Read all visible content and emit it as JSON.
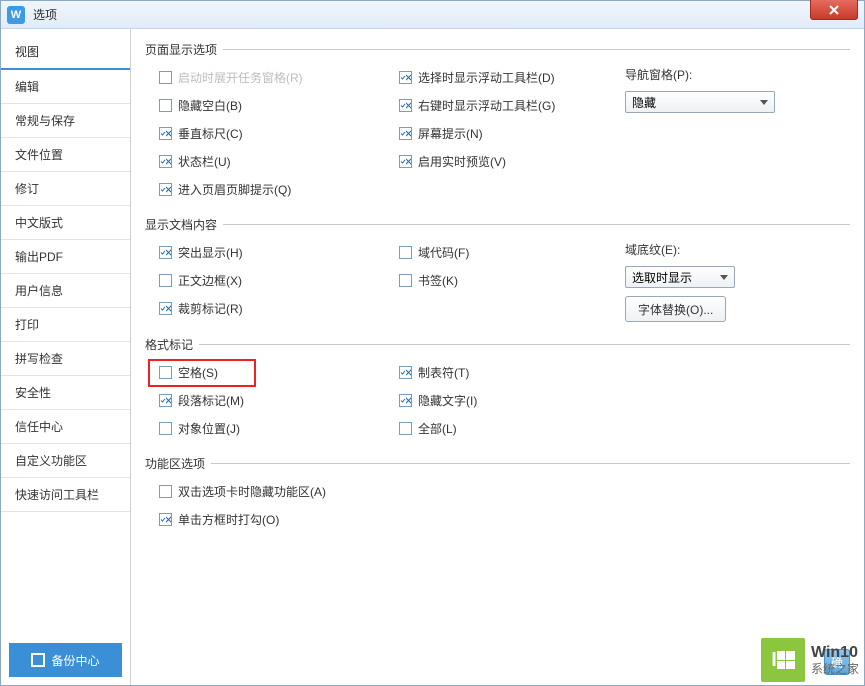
{
  "title": "选项",
  "sidebar": {
    "tabs": [
      "视图",
      "编辑",
      "常规与保存",
      "文件位置",
      "修订",
      "中文版式",
      "输出PDF",
      "用户信息",
      "打印",
      "拼写检查",
      "安全性",
      "信任中心",
      "自定义功能区",
      "快速访问工具栏"
    ],
    "selected_index": 0,
    "backup_label": "备份中心"
  },
  "groups": {
    "page_display": {
      "legend": "页面显示选项",
      "col1": [
        {
          "label": "启动时展开任务窗格(R)",
          "checked": false,
          "disabled": true
        },
        {
          "label": "隐藏空白(B)",
          "checked": false
        },
        {
          "label": "垂直标尺(C)",
          "checked": true
        },
        {
          "label": "状态栏(U)",
          "checked": true
        },
        {
          "label": "进入页眉页脚提示(Q)",
          "checked": true
        }
      ],
      "col2": [
        {
          "label": "选择时显示浮动工具栏(D)",
          "checked": true
        },
        {
          "label": "右键时显示浮动工具栏(G)",
          "checked": true
        },
        {
          "label": "屏幕提示(N)",
          "checked": true
        },
        {
          "label": "启用实时预览(V)",
          "checked": true
        }
      ],
      "nav_label": "导航窗格(P):",
      "nav_value": "隐藏"
    },
    "doc_content": {
      "legend": "显示文档内容",
      "col1": [
        {
          "label": "突出显示(H)",
          "checked": true
        },
        {
          "label": "正文边框(X)",
          "checked": false
        },
        {
          "label": "裁剪标记(R)",
          "checked": true
        }
      ],
      "col2": [
        {
          "label": "域代码(F)",
          "checked": false
        },
        {
          "label": "书签(K)",
          "checked": false
        }
      ],
      "field_shading_label": "域底纹(E):",
      "field_shading_value": "选取时显示",
      "font_replace_btn": "字体替换(O)..."
    },
    "format_marks": {
      "legend": "格式标记",
      "col1": [
        {
          "label": "空格(S)",
          "checked": false,
          "highlighted": true
        },
        {
          "label": "段落标记(M)",
          "checked": true
        },
        {
          "label": "对象位置(J)",
          "checked": false
        }
      ],
      "col2": [
        {
          "label": "制表符(T)",
          "checked": true
        },
        {
          "label": "隐藏文字(I)",
          "checked": true
        },
        {
          "label": "全部(L)",
          "checked": false
        }
      ]
    },
    "ribbon": {
      "legend": "功能区选项",
      "items": [
        {
          "label": "双击选项卡时隐藏功能区(A)",
          "checked": false
        },
        {
          "label": "单击方框时打勾(O)",
          "checked": true
        }
      ]
    }
  },
  "bottom_ok": "确",
  "watermark": {
    "line1": "Win10",
    "line2": "系统之家"
  }
}
